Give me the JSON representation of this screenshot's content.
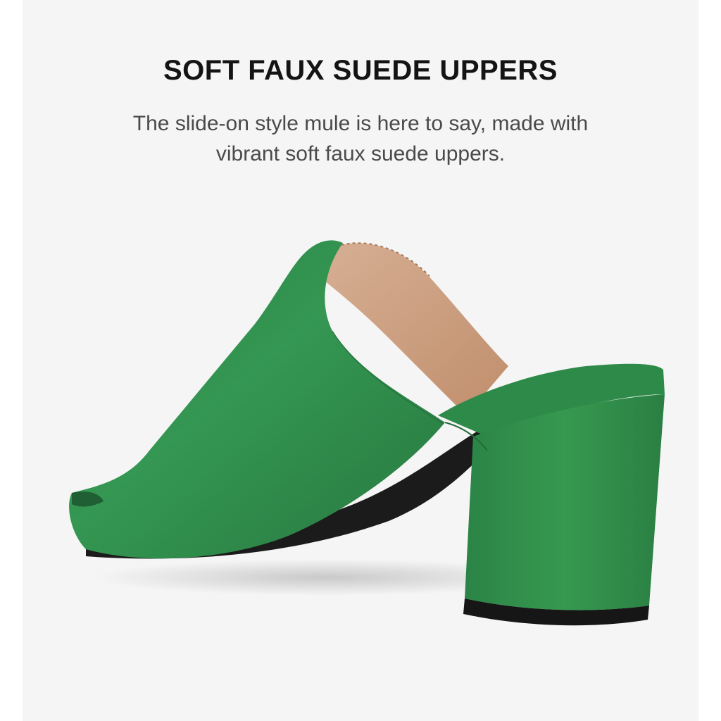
{
  "feature": {
    "title": "SOFT FAUX SUEDE UPPERS",
    "description": "The slide-on style mule is here to say, made with vibrant soft faux suede uppers."
  },
  "product_image": {
    "subject": "green faux suede block heel peep-toe mule",
    "colors": {
      "suede": "#2e8b4a",
      "suede_dark": "#1f6b36",
      "lining": "#cfa283",
      "sole": "#1a1a1a",
      "background": "#f5f5f5"
    }
  }
}
